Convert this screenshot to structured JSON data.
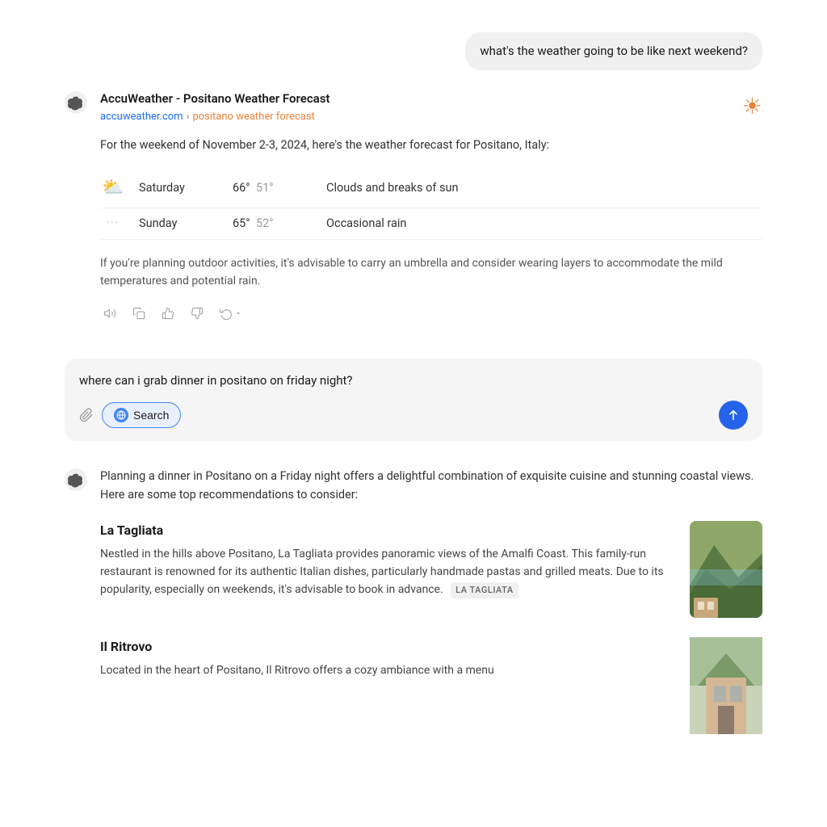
{
  "user_message_1": {
    "text": "what's the weather going to be like next weekend?"
  },
  "weather_response": {
    "source_title": "AccuWeather - Positano Weather Forecast",
    "breadcrumb_site": "accuweather.com",
    "breadcrumb_separator": "›",
    "breadcrumb_page": "positano weather forecast",
    "intro": "For the weekend of November 2-3, 2024, here's the weather forecast for Positano, Italy:",
    "days": [
      {
        "day": "Saturday",
        "high": "66°",
        "low": "51°",
        "description": "Clouds and breaks of sun",
        "icon": "partly_cloudy"
      },
      {
        "day": "Sunday",
        "high": "65°",
        "low": "52°",
        "description": "Occasional rain",
        "icon": "rain"
      }
    ],
    "advice": "If you're planning outdoor activities, it's advisable to carry an umbrella and consider wearing layers to accommodate the mild temperatures and potential rain."
  },
  "action_buttons": {
    "speak": "🔊",
    "copy": "⧉",
    "thumbs_up": "👍",
    "thumbs_down": "👎",
    "refresh": "↻"
  },
  "input_area": {
    "text": "where can i grab dinner in positano on friday night?",
    "search_label": "Search",
    "attach_icon": "📎"
  },
  "restaurant_response": {
    "intro": "Planning a dinner in Positano on a Friday night offers a delightful combination of exquisite cuisine and stunning coastal views. Here are some top recommendations to consider:",
    "restaurants": [
      {
        "name": "La Tagliata",
        "description": "Nestled in the hills above Positano, La Tagliata provides panoramic views of the Amalfi Coast. This family-run restaurant is renowned for its authentic Italian dishes, particularly handmade pastas and grilled meats. Due to its popularity, especially on weekends, it's advisable to book in advance.",
        "tag": "LA TAGLIATA"
      },
      {
        "name": "Il Ritrovo",
        "description": "Located in the heart of Positano, Il Ritrovo offers a cozy ambiance with a menu",
        "tag": ""
      }
    ]
  }
}
